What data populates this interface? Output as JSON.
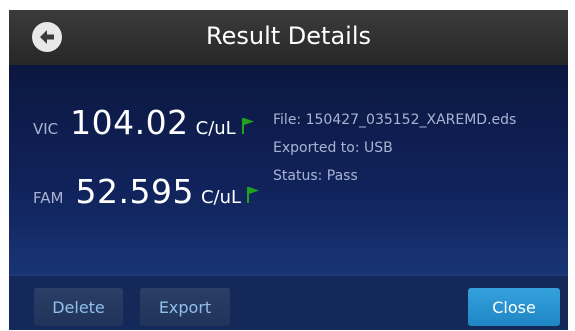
{
  "header": {
    "title": "Result Details",
    "back_icon": "arrow-left-circle-icon"
  },
  "results": [
    {
      "dye": "VIC",
      "value": "104.02",
      "unit": "C/uL",
      "flag_color": "#1fa31f"
    },
    {
      "dye": "FAM",
      "value": "52.595",
      "unit": "C/uL",
      "flag_color": "#1fa31f"
    }
  ],
  "info": {
    "file": "File: 150427_035152_XAREMD.eds",
    "exported": "Exported to: USB",
    "status": "Status: Pass"
  },
  "footer": {
    "delete_label": "Delete",
    "export_label": "Export",
    "close_label": "Close"
  },
  "colors": {
    "primary_button": "#2a93d1",
    "background": "#0f1f52"
  }
}
